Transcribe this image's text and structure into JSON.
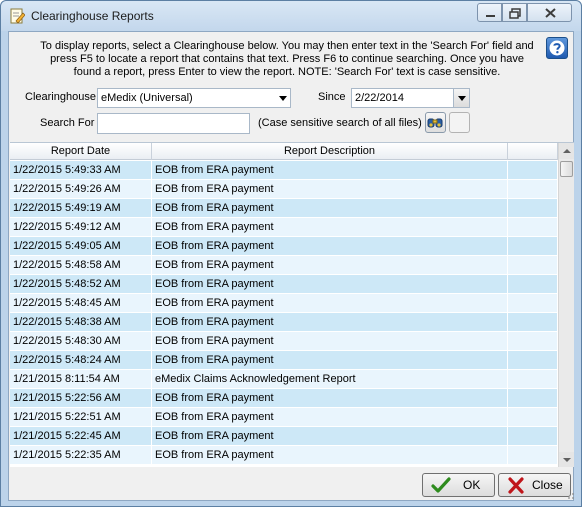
{
  "window": {
    "title": "Clearinghouse Reports",
    "controls": {
      "minimize_icon": "minimize-icon",
      "maximize_icon": "maximize-icon",
      "close_icon": "close-icon"
    }
  },
  "instructions": {
    "line1": "To display reports, select a Clearinghouse below.  You may then enter text in the 'Search For' field and",
    "line2": "press F5 to locate a report that contains that text.  Press F6 to continue searching.  Once you have",
    "line3": "found a report, press Enter to view the report.  NOTE: 'Search For' text is case sensitive."
  },
  "filters": {
    "clearinghouse_label": "Clearinghouse",
    "clearinghouse_value": "eMedix (Universal)",
    "since_label": "Since",
    "since_value": "2/22/2014",
    "search_label": "Search For",
    "search_value": "",
    "search_hint": "(Case sensitive search of all files)"
  },
  "table": {
    "columns": [
      "Report Date",
      "Report Description",
      ""
    ],
    "rows": [
      {
        "date": "1/22/2015 5:49:33 AM",
        "description": "EOB from ERA payment"
      },
      {
        "date": "1/22/2015 5:49:26 AM",
        "description": "EOB from ERA payment"
      },
      {
        "date": "1/22/2015 5:49:19 AM",
        "description": "EOB from ERA payment"
      },
      {
        "date": "1/22/2015 5:49:12 AM",
        "description": "EOB from ERA payment"
      },
      {
        "date": "1/22/2015 5:49:05 AM",
        "description": "EOB from ERA payment"
      },
      {
        "date": "1/22/2015 5:48:58 AM",
        "description": "EOB from ERA payment"
      },
      {
        "date": "1/22/2015 5:48:52 AM",
        "description": "EOB from ERA payment"
      },
      {
        "date": "1/22/2015 5:48:45 AM",
        "description": "EOB from ERA payment"
      },
      {
        "date": "1/22/2015 5:48:38 AM",
        "description": "EOB from ERA payment"
      },
      {
        "date": "1/22/2015 5:48:30 AM",
        "description": "EOB from ERA payment"
      },
      {
        "date": "1/22/2015 5:48:24 AM",
        "description": "EOB from ERA payment"
      },
      {
        "date": "1/21/2015 8:11:54 AM",
        "description": "eMedix Claims Acknowledgement Report"
      },
      {
        "date": "1/21/2015 5:22:56 AM",
        "description": "EOB from ERA payment"
      },
      {
        "date": "1/21/2015 5:22:51 AM",
        "description": "EOB from ERA payment"
      },
      {
        "date": "1/21/2015 5:22:45 AM",
        "description": "EOB from ERA payment"
      },
      {
        "date": "1/21/2015 5:22:35 AM",
        "description": "EOB from ERA payment"
      }
    ]
  },
  "buttons": {
    "ok_label": "OK",
    "close_label": "Close"
  },
  "icons": {
    "app": "document-edit-icon",
    "help": "help-icon",
    "search": "binoculars-icon",
    "ok": "checkmark-icon",
    "close": "x-icon"
  },
  "colors": {
    "row_odd": "#cde8f7",
    "row_even": "#e9f5fd",
    "ok_check": "#2e8b1e",
    "close_x": "#c0161b",
    "help_blue": "#1f5ab0"
  }
}
